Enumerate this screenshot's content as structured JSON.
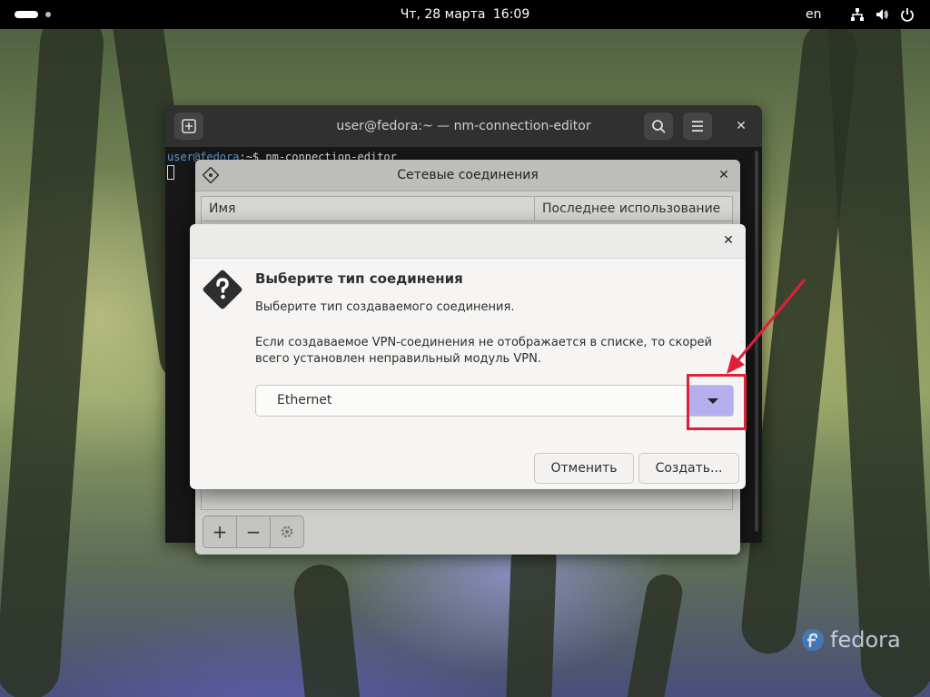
{
  "topbar": {
    "date": "Чт, 28 марта",
    "time": "16:09",
    "language": "en",
    "icons": [
      "network-icon",
      "volume-icon",
      "power-icon"
    ]
  },
  "terminal": {
    "title": "user@fedora:~ — nm-connection-editor",
    "prompt_user": "user@fedora",
    "prompt_rest": ":~$ nm-connection-editor",
    "buttons": [
      "new-tab-icon",
      "search-icon",
      "menu-icon",
      "close-icon"
    ]
  },
  "nm_window": {
    "title": "Сетевые соединения",
    "columns": [
      "Имя",
      "Последнее использование"
    ],
    "toolbar": [
      "add-icon",
      "remove-icon",
      "gear-icon"
    ]
  },
  "dialog": {
    "heading": "Выберите тип соединения",
    "subtitle": "Выберите тип создаваемого соединения.",
    "note": "Если создаваемое VPN-соединения не отображается в списке, то скорей всего установлен неправильный модуль VPN.",
    "select_value": "Ethernet",
    "cancel_label": "Отменить",
    "create_label": "Создать..."
  },
  "watermark": {
    "brand": "fedora"
  },
  "colors": {
    "highlight": "#e0203a",
    "dropdown_arrow_bg": "#b4b0f0",
    "topbar": "#000000"
  }
}
